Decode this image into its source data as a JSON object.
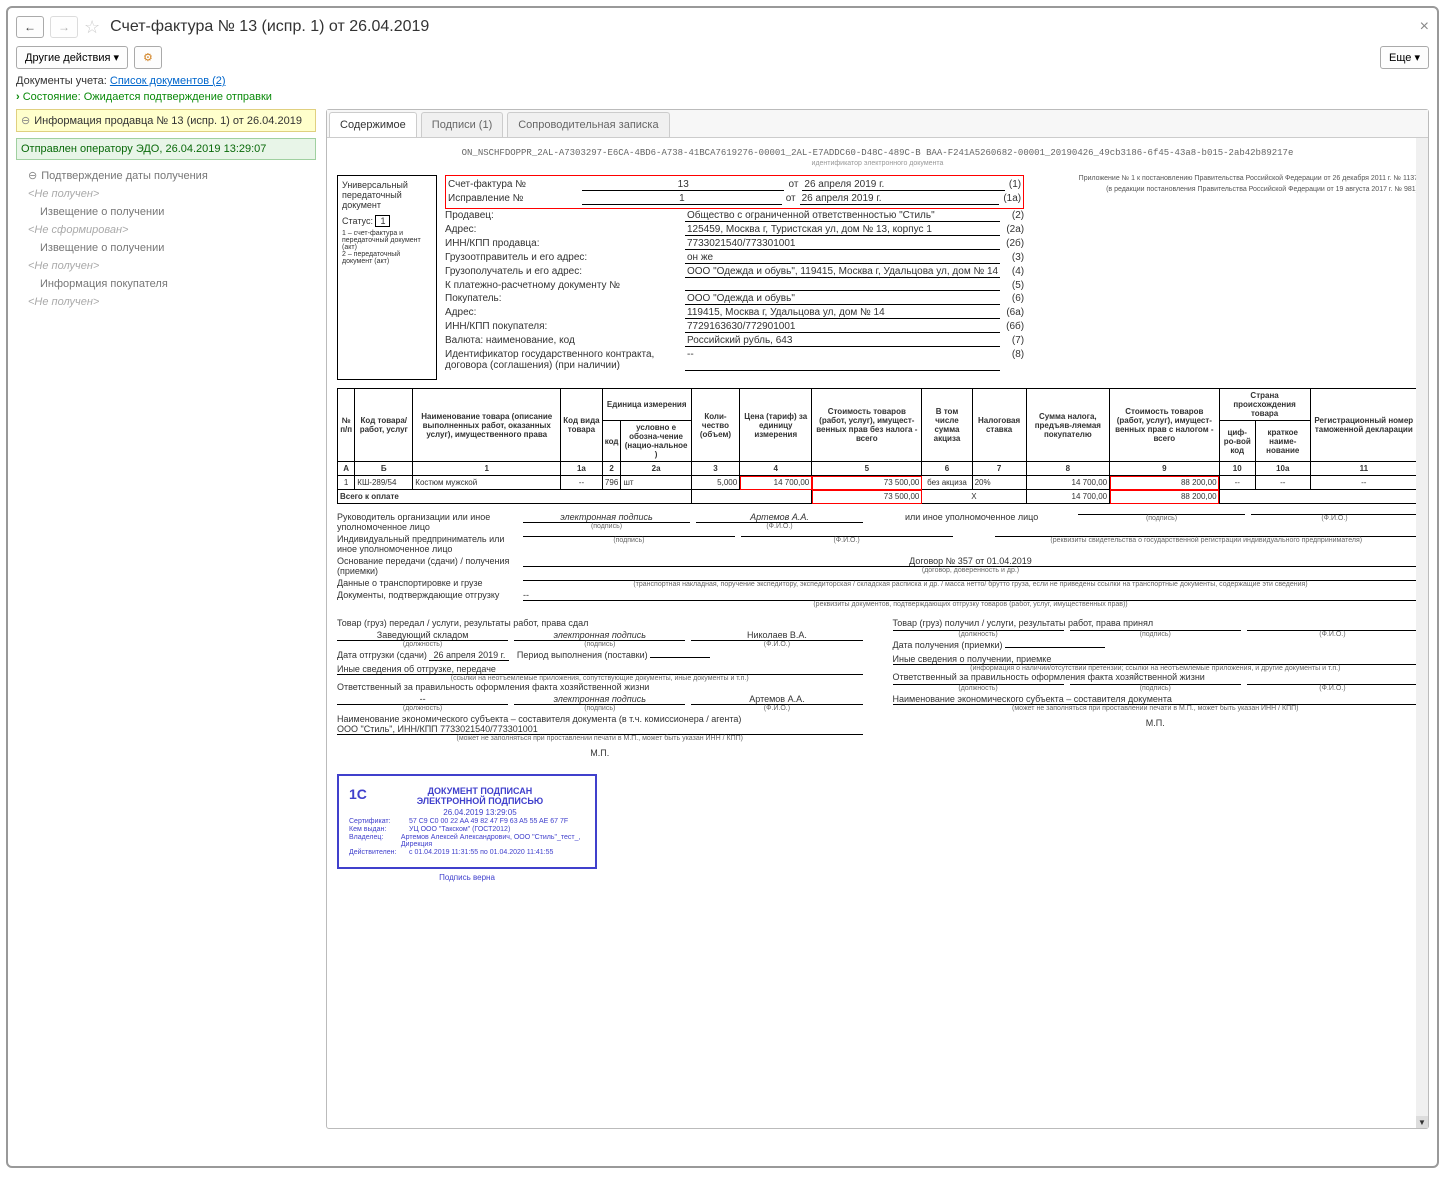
{
  "title": "Счет-фактура № 13 (испр. 1) от 26.04.2019",
  "toolbar": {
    "other_actions": "Другие действия",
    "more": "Еще"
  },
  "links": {
    "docs_label": "Документы учета:",
    "docs_link": "Список документов (2)"
  },
  "status": "Состояние: Ожидается подтверждение отправки",
  "sidebar": {
    "info": "Информация продавца № 13 (испр. 1) от 26.04.2019",
    "sent": "Отправлен оператору ЭДО, 26.04.2019 13:29:07",
    "tree": [
      "Подтверждение даты получения",
      "<Не получен>",
      "Извещение о получении",
      "<Не сформирован>",
      "Извещение о получении",
      "<Не получен>",
      "Информация покупателя",
      "<Не получен>"
    ]
  },
  "tabs": {
    "content": "Содержимое",
    "sigs": "Подписи (1)",
    "note": "Сопроводительная записка"
  },
  "doc": {
    "filename": "ON_NSCHFDOPPR_2AL-A7303297-E6CA-4BD6-A738-41BCA7619276-00001_2AL-E7ADDC60-D48C-489C-B BAA-F241A5260682-00001_20190426_49cb3186-6f45-43a8-b015-2ab42b89217e",
    "filename_sub": "идентификатор электронного документа",
    "annex1": "Приложение № 1 к постановлению Правительства Российской Федерации от 26 декабря 2011 г. № 1137",
    "annex2": "(в редакции постановления Правительства Российской Федерации от 19 августа 2017 г. № 981)",
    "left_label": "Универсальный передаточный документ",
    "status_lbl": "Статус:",
    "status_val": "1",
    "status_note1": "1 – счет-фактура и передаточный документ (акт)",
    "status_note2": "2 – передаточный документ (акт)",
    "invoice_lbl": "Счет-фактура №",
    "invoice_no": "13",
    "ot": "от",
    "invoice_date": "26 апреля 2019 г.",
    "corr_lbl": "Исправление №",
    "corr_no": "1",
    "corr_date": "26 апреля 2019 г.",
    "rows": [
      {
        "lbl": "Продавец:",
        "val": "Общество с ограниченной ответственностью \"Стиль\"",
        "n": "(2)"
      },
      {
        "lbl": "Адрес:",
        "val": "125459, Москва г, Туристская ул, дом № 13, корпус 1",
        "n": "(2а)"
      },
      {
        "lbl": "ИНН/КПП продавца:",
        "val": "7733021540/773301001",
        "n": "(2б)"
      },
      {
        "lbl": "Грузоотправитель и его адрес:",
        "val": "он же",
        "n": "(3)"
      },
      {
        "lbl": "Грузополучатель и его адрес:",
        "val": "ООО \"Одежда и обувь\", 119415, Москва г, Удальцова ул, дом № 14",
        "n": "(4)"
      },
      {
        "lbl": "К платежно-расчетному документу №",
        "val": "",
        "n": "(5)"
      },
      {
        "lbl": "Покупатель:",
        "val": "ООО \"Одежда и обувь\"",
        "n": "(6)"
      },
      {
        "lbl": "Адрес:",
        "val": "119415, Москва г, Удальцова ул, дом № 14",
        "n": "(6а)"
      },
      {
        "lbl": "ИНН/КПП покупателя:",
        "val": "7729163630/772901001",
        "n": "(6б)"
      },
      {
        "lbl": "Валюта: наименование, код",
        "val": "Российский рубль, 643",
        "n": "(7)"
      },
      {
        "lbl": "Идентификатор государственного контракта, договора (соглашения) (при наличии)",
        "val": "--",
        "n": "(8)"
      }
    ],
    "th": {
      "n": "№ п/п",
      "code": "Код товара/ работ, услуг",
      "name": "Наименование товара (описание выполненных работ, оказанных услуг), имущественного права",
      "kvt": "Код вида товара",
      "unit": "Единица измерения",
      "ukod": "код",
      "usym": "условно е обозна-чение (нацио-нальное )",
      "qty": "Коли-чество (объем)",
      "price": "Цена (тариф) за единицу измерения",
      "cost": "Стоимость товаров (работ, услуг), имущест-венных прав без налога - всего",
      "excise": "В том числе сумма акциза",
      "rate": "Налоговая ставка",
      "tax": "Сумма налога, предъяв-ляемая покупателю",
      "total": "Стоимость товаров (работ, услуг), имущест-венных прав с налогом - всего",
      "country": "Страна происхождения товара",
      "cc": "циф-ро-вой код",
      "cn": "краткое наиме-нование",
      "decl": "Регистрационный номер таможенной декларации"
    },
    "thn": [
      "А",
      "Б",
      "1",
      "1а",
      "2",
      "2а",
      "3",
      "4",
      "5",
      "6",
      "7",
      "8",
      "9",
      "10",
      "10а",
      "11"
    ],
    "item": {
      "n": "1",
      "code": "КШ-289/54",
      "name": "Костюм мужской",
      "kvt": "--",
      "ukod": "796",
      "usym": "шт",
      "qty": "5,000",
      "price": "14 700,00",
      "cost": "73 500,00",
      "excise": "без акциза",
      "rate": "20%",
      "tax": "14 700,00",
      "total": "88 200,00",
      "cc": "--",
      "cn": "--",
      "decl": "--"
    },
    "totals": {
      "lbl": "Всего к оплате",
      "cost": "73 500,00",
      "x": "Х",
      "tax": "14 700,00",
      "total": "88 200,00"
    },
    "sig": {
      "l1": "Руководитель организации или иное уполномоченное лицо",
      "l2": "Индивидуальный предприниматель или иное уполномоченное лицо",
      "esig": "электронная подпись",
      "name1": "Артемов А.А.",
      "r1": "или иное уполномоченное лицо",
      "sub_p": "(подпись)",
      "sub_f": "(Ф.И.О.)",
      "rekv": "(реквизиты свидетельства о государственной регистрации индивидуального предпринимателя)"
    },
    "basis_lbl": "Основание передачи (сдачи) / получения (приемки)",
    "basis_val": "Договор № 357 от 01.04.2019",
    "basis_sub": "(договор, доверенность и др.)",
    "trans_lbl": "Данные о транспортировке и грузе",
    "trans_sub": "(транспортная накладная, поручение экспедитору, экспедиторская / складская расписка и др. / масса нетто/ брутто груза, если не приведены ссылки на транспортные документы, содержащие эти сведения)",
    "ship_lbl": "Документы, подтверждающие отгрузку",
    "ship_val": "--",
    "ship_sub": "(реквизиты документов, подтверждающих отгрузку товаров (работ, услуг, имущественных прав))",
    "left": {
      "h1": "Товар (груз) передал / услуги, результаты работ, права сдал",
      "pos": "Заведующий складом",
      "name": "Николаев В.А.",
      "date_lbl": "Дата отгрузки (сдачи)",
      "date": "26 апреля 2019 г.",
      "period": "Период выполнения (поставки)",
      "other": "Иные сведения об отгрузке, передаче",
      "other_sub": "(ссылки на неотъемлемые приложения, сопутствующие документы, иные документы и т.п.)",
      "resp": "Ответственный за правильность оформления факта хозяйственной жизни",
      "resp_pos": "--",
      "resp_name": "Артемов А.А.",
      "econ": "Наименование экономического субъекта – составителя документа (в т.ч. комиссионера / агента)",
      "econ_val": "ООО \"Стиль\", ИНН/КПП 7733021540/773301001",
      "econ_sub": "(может не заполняться при проставлении печати в М.П., может быть указан ИНН / КПП)",
      "mp": "М.П."
    },
    "right": {
      "h1": "Товар (груз) получил / услуги, результаты работ, права принял",
      "date_lbl": "Дата получения (приемки)",
      "other": "Иные сведения о получении, приемке",
      "other_sub": "(информация о наличии/отсутствии претензии; ссылки на неотъемлемые приложения, и другие документы и т.п.)",
      "resp": "Ответственный за правильность оформления факта хозяйственной жизни",
      "econ": "Наименование экономического субъекта – составителя документа",
      "econ_sub": "(может не заполняться при проставлении печати в М.П., может быть указан ИНН / КПП)",
      "mp": "М.П."
    },
    "pos_sub": "(должность)",
    "stamp": {
      "h1": "ДОКУМЕНТ ПОДПИСАН",
      "h2": "ЭЛЕКТРОННОЙ ПОДПИСЬЮ",
      "ts": "26.04.2019 13:29:05",
      "cert_k": "Сертификат:",
      "cert_v": "57 C9 C0 00 22 AA 49 82 47 F9 63 A5 55 AE 67 7F",
      "iss_k": "Кем выдан:",
      "iss_v": "УЦ ООО \"Такском\" (ГОСТ2012)",
      "own_k": "Владелец:",
      "own_v": "Артемов Алексей Александрович, ООО \"Стиль\"_тест_, Дирекция",
      "valid_k": "Действителен:",
      "valid_v": "с 01.04.2019 11:31:55 по 01.04.2020 11:41:55",
      "ok": "Подпись верна"
    }
  }
}
